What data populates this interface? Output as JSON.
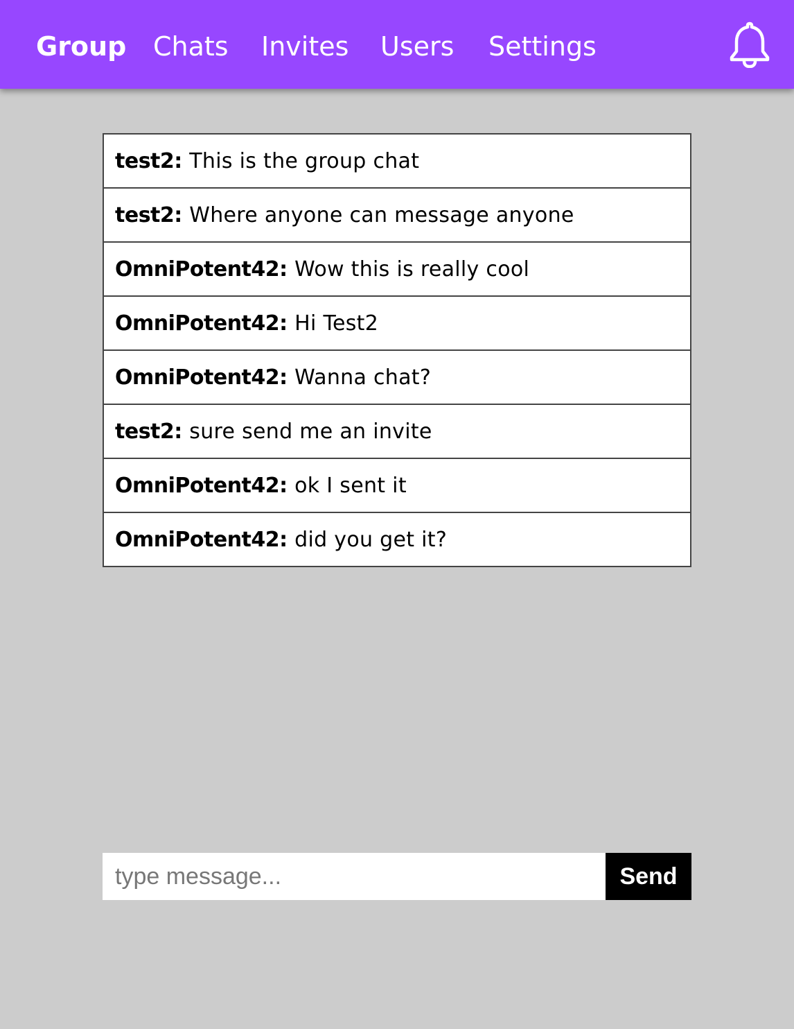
{
  "nav": {
    "items": [
      {
        "label": "Group",
        "active": true
      },
      {
        "label": "Chats"
      },
      {
        "label": "Invites"
      },
      {
        "label": "Users"
      },
      {
        "label": "Settings"
      }
    ],
    "notification_icon": "bell-icon",
    "background_color": "#9747ff"
  },
  "messages": [
    {
      "author": "test2",
      "text": "This is the group chat"
    },
    {
      "author": "test2",
      "text": "Where anyone can message anyone"
    },
    {
      "author": "OmniPotent42",
      "text": "Wow this is really cool"
    },
    {
      "author": "OmniPotent42",
      "text": "Hi Test2"
    },
    {
      "author": "OmniPotent42",
      "text": "Wanna chat?"
    },
    {
      "author": "test2",
      "text": "sure send me an invite"
    },
    {
      "author": "OmniPotent42",
      "text": "ok I sent it"
    },
    {
      "author": "OmniPotent42",
      "text": "did you get it?"
    }
  ],
  "composer": {
    "placeholder": "type message...",
    "value": "",
    "send_label": "Send"
  }
}
